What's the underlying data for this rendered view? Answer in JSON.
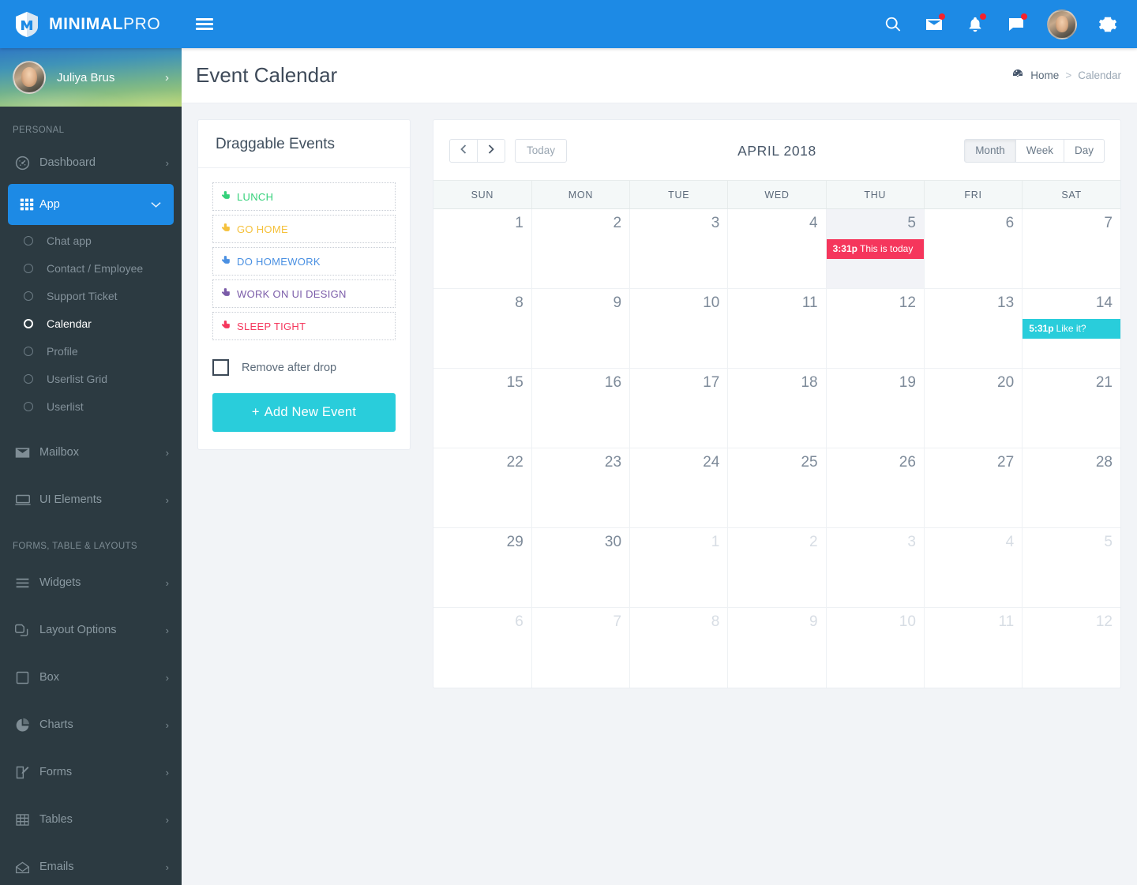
{
  "brand": {
    "bold": "MINIMAL",
    "light": "PRO",
    "logo_icon": "shield-m-logo-icon"
  },
  "topbar": {
    "menu_toggle_icon": "hamburger-icon",
    "icons": [
      {
        "name": "search-icon",
        "badge": false
      },
      {
        "name": "mail-icon",
        "badge": true
      },
      {
        "name": "bell-icon",
        "badge": true
      },
      {
        "name": "chat-icon",
        "badge": true
      }
    ],
    "avatar_alt": "user-avatar",
    "settings_icon": "gear-icon"
  },
  "sidebar": {
    "profile": {
      "name": "Juliya Brus",
      "caret": "›"
    },
    "sections": [
      {
        "label": "PERSONAL",
        "items": [
          {
            "label": "Dashboard",
            "icon": "speedometer-icon",
            "caret": "›",
            "active": false
          },
          {
            "label": "App",
            "icon": "grid-icon",
            "caret": "ˇ",
            "active": true,
            "children": [
              {
                "label": "Chat app",
                "active": false
              },
              {
                "label": "Contact / Employee",
                "active": false
              },
              {
                "label": "Support Ticket",
                "active": false
              },
              {
                "label": "Calendar",
                "active": true
              },
              {
                "label": "Profile",
                "active": false
              },
              {
                "label": "Userlist Grid",
                "active": false
              },
              {
                "label": "Userlist",
                "active": false
              }
            ]
          },
          {
            "label": "Mailbox",
            "icon": "envelope-icon",
            "caret": "›",
            "active": false
          },
          {
            "label": "UI Elements",
            "icon": "window-icon",
            "caret": "›",
            "active": false
          }
        ]
      },
      {
        "label": "FORMS, TABLE & LAYOUTS",
        "items": [
          {
            "label": "Widgets",
            "icon": "list-icon",
            "caret": "›",
            "active": false
          },
          {
            "label": "Layout Options",
            "icon": "layers-icon",
            "caret": "›",
            "active": false
          },
          {
            "label": "Box",
            "icon": "square-icon",
            "caret": "›",
            "active": false
          },
          {
            "label": "Charts",
            "icon": "pie-chart-icon",
            "caret": "›",
            "active": false
          },
          {
            "label": "Forms",
            "icon": "edit-icon",
            "caret": "›",
            "active": false
          },
          {
            "label": "Tables",
            "icon": "table-icon",
            "caret": "›",
            "active": false
          },
          {
            "label": "Emails",
            "icon": "open-envelope-icon",
            "caret": "›",
            "active": false
          }
        ]
      }
    ]
  },
  "page": {
    "title": "Event Calendar",
    "breadcrumb": {
      "home_icon": "dashboard-icon",
      "home": "Home",
      "separator": ">",
      "current": "Calendar"
    }
  },
  "draggable_panel": {
    "title": "Draggable Events",
    "events": [
      {
        "label": "LUNCH",
        "color": "#34d17a"
      },
      {
        "label": "GO HOME",
        "color": "#f5c13b"
      },
      {
        "label": "DO HOMEWORK",
        "color": "#4a90e2"
      },
      {
        "label": "WORK ON UI DESIGN",
        "color": "#7a5ba8"
      },
      {
        "label": "SLEEP TIGHT",
        "color": "#f5365c"
      }
    ],
    "grab_icon": "hand-pointer-icon",
    "checkbox": {
      "label": "Remove after drop",
      "checked": false
    },
    "add_button": {
      "plus": "+",
      "label": "Add New Event"
    }
  },
  "calendar": {
    "toolbar": {
      "prev_icon": "chevron-left-icon",
      "next_icon": "chevron-right-icon",
      "today_label": "Today",
      "title": "APRIL 2018",
      "views": [
        {
          "label": "Month",
          "active": true
        },
        {
          "label": "Week",
          "active": false
        },
        {
          "label": "Day",
          "active": false
        }
      ]
    },
    "weekdays": [
      "SUN",
      "MON",
      "TUE",
      "WED",
      "THU",
      "FRI",
      "SAT"
    ],
    "weeks": [
      [
        {
          "day": "1",
          "other": false
        },
        {
          "day": "2",
          "other": false
        },
        {
          "day": "3",
          "other": false
        },
        {
          "day": "4",
          "other": false
        },
        {
          "day": "5",
          "other": false,
          "today": true,
          "event": {
            "time": "3:31p",
            "title": "This is today",
            "color": "#f5365c"
          }
        },
        {
          "day": "6",
          "other": false
        },
        {
          "day": "7",
          "other": false
        }
      ],
      [
        {
          "day": "8",
          "other": false
        },
        {
          "day": "9",
          "other": false
        },
        {
          "day": "10",
          "other": false
        },
        {
          "day": "11",
          "other": false
        },
        {
          "day": "12",
          "other": false
        },
        {
          "day": "13",
          "other": false
        },
        {
          "day": "14",
          "other": false,
          "event": {
            "time": "5:31p",
            "title": "Like it?",
            "color": "#29cddb"
          }
        }
      ],
      [
        {
          "day": "15",
          "other": false
        },
        {
          "day": "16",
          "other": false
        },
        {
          "day": "17",
          "other": false
        },
        {
          "day": "18",
          "other": false
        },
        {
          "day": "19",
          "other": false
        },
        {
          "day": "20",
          "other": false
        },
        {
          "day": "21",
          "other": false
        }
      ],
      [
        {
          "day": "22",
          "other": false
        },
        {
          "day": "23",
          "other": false
        },
        {
          "day": "24",
          "other": false
        },
        {
          "day": "25",
          "other": false
        },
        {
          "day": "26",
          "other": false
        },
        {
          "day": "27",
          "other": false
        },
        {
          "day": "28",
          "other": false
        }
      ],
      [
        {
          "day": "29",
          "other": false
        },
        {
          "day": "30",
          "other": false
        },
        {
          "day": "1",
          "other": true
        },
        {
          "day": "2",
          "other": true
        },
        {
          "day": "3",
          "other": true
        },
        {
          "day": "4",
          "other": true
        },
        {
          "day": "5",
          "other": true
        }
      ],
      [
        {
          "day": "6",
          "other": true
        },
        {
          "day": "7",
          "other": true
        },
        {
          "day": "8",
          "other": true
        },
        {
          "day": "9",
          "other": true
        },
        {
          "day": "10",
          "other": true
        },
        {
          "day": "11",
          "other": true
        },
        {
          "day": "12",
          "other": true
        }
      ]
    ]
  },
  "colors": {
    "primary": "#1d8ae5",
    "sidebar": "#2c3a41",
    "accent_teal": "#29cddb",
    "accent_pink": "#f5365c",
    "page_bg": "#f2f4f7"
  }
}
